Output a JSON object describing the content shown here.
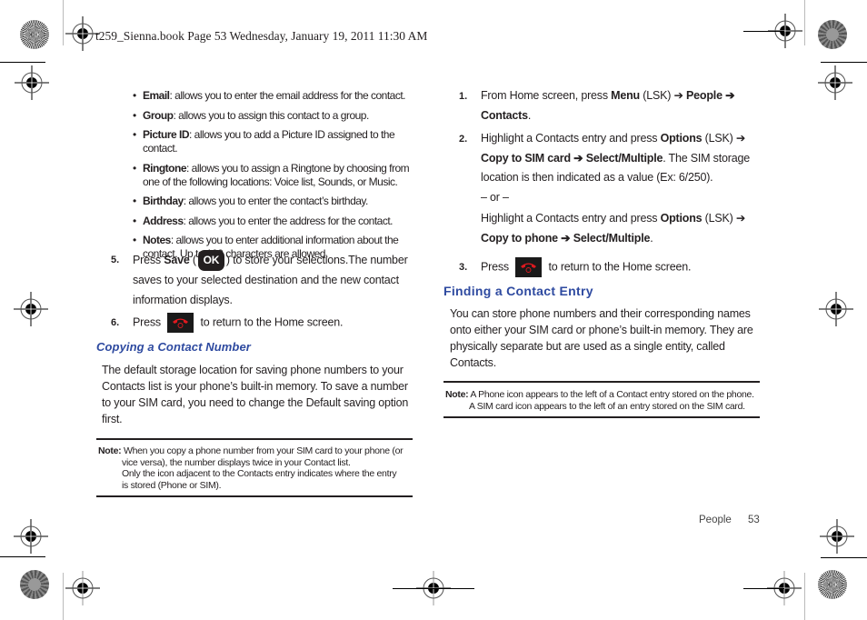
{
  "print_header": "t259_Sienna.book  Page 53  Wednesday, January 19, 2011  11:30 AM",
  "left_column": {
    "bullets": [
      {
        "term": "Email",
        "text": ": allows you to enter the email address for the contact."
      },
      {
        "term": "Group",
        "text": ": allows you to assign this contact to a group."
      },
      {
        "term": "Picture ID",
        "text": ": allows you to add a Picture ID assigned to the contact."
      },
      {
        "term": "Ringtone",
        "text": ": allows you to assign a Ringtone by choosing from one of the following locations: Voice list, Sounds, or Music."
      },
      {
        "term": "Birthday",
        "text": ": allows you to enter the contact’s birthday."
      },
      {
        "term": "Address",
        "text": ": allows you to enter the address for the contact."
      },
      {
        "term": "Notes",
        "text": ": allows you to enter additional information about the contact. Up to 100 characters are allowed."
      }
    ],
    "step5": {
      "num": "5.",
      "pre": "Press ",
      "bold": "Save",
      "paren_open": " (",
      "key_label": "OK",
      "post_line1": ") to store your selections.The number",
      "line2": "saves to your selected destination and the new contact",
      "line3": "information displays."
    },
    "step6": {
      "num": "6.",
      "pre": "Press",
      "post": "to return to the Home screen."
    },
    "section_title": "Copying a Contact Number",
    "paragraph": "The default storage location for saving phone numbers to your Contacts list is your phone’s built-in memory. To save a number to your SIM card, you need to change the Default saving option first.",
    "note": {
      "label": "Note:",
      "line1": "When you copy a phone number from your SIM card to your phone (or",
      "line2": "vice versa), the number displays twice in your Contact list.",
      "line3": "Only the icon adjacent to the Contacts entry indicates where the entry",
      "line4": "is stored (Phone or SIM)."
    }
  },
  "right_column": {
    "step1": {
      "num": "1.",
      "pre": "From Home screen, press ",
      "b1": "Menu",
      "mid": " (LSK) ➔ ",
      "b2": "People",
      "arrow": "  ➔",
      "b3": "Contacts",
      "end": "."
    },
    "step2": {
      "num": "2.",
      "pre": "Highlight a Contacts entry and press ",
      "b1": "Options",
      "mid": " (LSK) ➔",
      "b2": "Copy to SIM card ➔ Select/Multiple",
      "post": ". The SIM storage",
      "line3": "location is then indicated as a value (Ex: 6/250).",
      "or": "– or –",
      "alt_pre": "Highlight a Contacts entry and press ",
      "alt_b1": "Options",
      "alt_mid": " (LSK) ➔",
      "alt_b2": "Copy to phone ➔ Select/Multiple",
      "alt_end": "."
    },
    "step3": {
      "num": "3.",
      "pre": "Press",
      "post": "to return to the Home screen."
    },
    "section_title": "Finding a Contact Entry",
    "paragraph_lines": [
      "You can store phone numbers and their corresponding names",
      "onto either your SIM card or phone’s built-in memory. They are",
      "physically separate but are used as a single entity, called",
      "Contacts."
    ],
    "note": {
      "label": "Note:",
      "line1": "A Phone icon appears to the left of a Contact entry stored on the phone.",
      "line2": "A SIM card icon appears to the left of an entry stored on the SIM card."
    }
  },
  "footer": {
    "section": "People",
    "page_number": "53"
  },
  "colors": {
    "heading_blue": "#2e4aa0",
    "text": "#231f20",
    "end_key_red": "#e0191f"
  },
  "icons": {
    "ok_key": "ok-key-icon",
    "end_key": "end-call-key-icon",
    "registration_mark": "registration-mark-icon",
    "color_rosette": "print-rosette-icon"
  }
}
